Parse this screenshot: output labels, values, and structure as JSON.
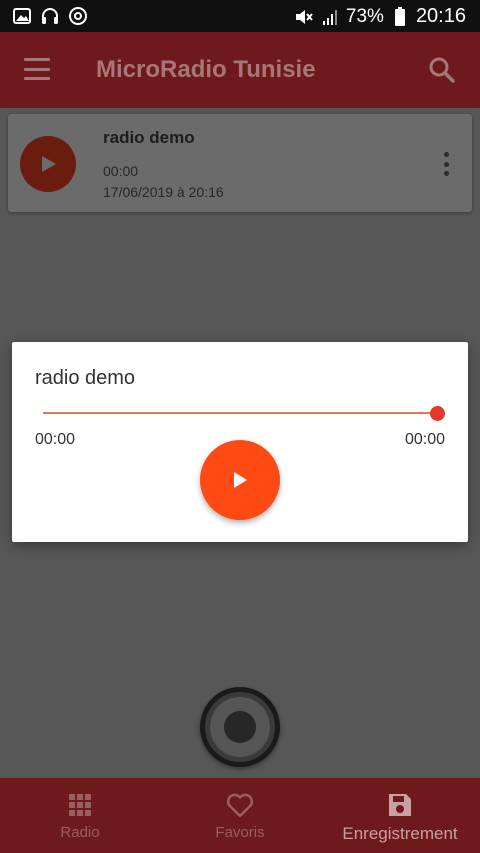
{
  "status_bar": {
    "battery": "73%",
    "time": "20:16",
    "left_icons": [
      "image-icon",
      "headset-icon",
      "at-sign-icon"
    ],
    "right_icons": [
      "mute-icon",
      "signal-icon",
      "battery-icon"
    ]
  },
  "app_bar": {
    "title": "MicroRadio Tunisie",
    "menu_icon": "menu-icon",
    "search_icon": "search-icon"
  },
  "recording": {
    "title": "radio demo",
    "duration": "00:00",
    "date": "17/06/2019 à 20:16"
  },
  "player_dialog": {
    "title": "radio demo",
    "elapsed": "00:00",
    "total": "00:00",
    "progress": 1.0
  },
  "bottom_nav": {
    "items": [
      {
        "label": "Radio",
        "icon": "grid-icon"
      },
      {
        "label": "Favoris",
        "icon": "heart-icon"
      },
      {
        "label": "Enregistrement",
        "icon": "floppy-disk-icon"
      }
    ],
    "active_index": 2
  },
  "colors": {
    "primary": "#6e1a1c",
    "accent": "#ff4a14",
    "seek_thumb": "#e23a2a"
  }
}
